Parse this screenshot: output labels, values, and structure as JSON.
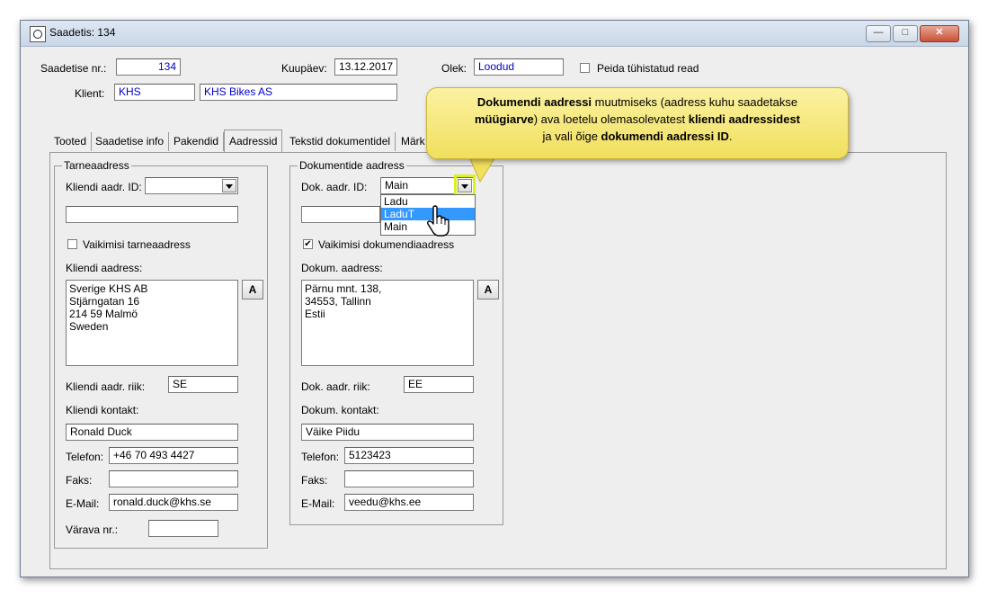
{
  "window": {
    "title": "Saadetis: 134",
    "controls": {
      "minimize": "—",
      "maximize": "□",
      "close": "✕"
    }
  },
  "header": {
    "saadetise_nr_label": "Saadetise nr.:",
    "saadetise_nr_value": "134",
    "kuupaev_label": "Kuupäev:",
    "kuupaev_value": "13.12.2017",
    "olek_label": "Olek:",
    "olek_value": "Loodud",
    "peida_label": "Peida tühistatud read",
    "klient_label": "Klient:",
    "klient_code": "KHS",
    "klient_name": "KHS Bikes AS"
  },
  "tabs": [
    {
      "label": "Tooted"
    },
    {
      "label": "Saadetise info"
    },
    {
      "label": "Pakendid"
    },
    {
      "label": "Aadressid"
    },
    {
      "label": "Tekstid dokumentidel"
    },
    {
      "label": "Märk"
    }
  ],
  "tarneaadress": {
    "legend": "Tarneaadress",
    "kliendi_aadr_id_label": "Kliendi aadr. ID:",
    "kliendi_aadr_id_value": "",
    "extra_field_value": "",
    "vaikimisi_label": "Vaikimisi tarneaadress",
    "kliendi_aadress_label": "Kliendi aadress:",
    "address_lines": [
      "Sverige KHS AB",
      "Stjärngatan 16",
      "214 59 Malmö",
      "Sweden"
    ],
    "a_button": "A",
    "riik_label": "Kliendi aadr. riik:",
    "riik_value": "SE",
    "kontakt_label": "Kliendi kontakt:",
    "kontakt_value": "Ronald Duck",
    "telefon_label": "Telefon:",
    "telefon_value": "+46 70 493 4427",
    "faks_label": "Faks:",
    "faks_value": "",
    "email_label": "E-Mail:",
    "email_value": "ronald.duck@khs.se",
    "varava_label": "Värava nr.:",
    "varava_value": ""
  },
  "dokumentide_aadress": {
    "legend": "Dokumentide aadress",
    "dok_aadr_id_label": "Dok. aadr. ID:",
    "dok_aadr_id_value": "Main",
    "dropdown_options": [
      "Ladu",
      "LaduT",
      "Main"
    ],
    "dropdown_selected": "LaduT",
    "extra_field_value": "",
    "vaikimisi_label": "Vaikimisi dokumendiaadress",
    "dokum_aadress_label": "Dokum. aadress:",
    "address_lines": [
      "Pärnu mnt. 138,",
      "34553, Tallinn",
      "Estii"
    ],
    "a_button": "A",
    "riik_label": "Dok. aadr. riik:",
    "riik_value": "EE",
    "kontakt_label": "Dokum. kontakt:",
    "kontakt_value": "Väike Piidu",
    "telefon_label": "Telefon:",
    "telefon_value": "5123423",
    "faks_label": "Faks:",
    "faks_value": "",
    "email_label": "E-Mail:",
    "email_value": "veedu@khs.ee"
  },
  "callout": {
    "part1": "Dokumendi aadressi",
    "part2": " muutmiseks (aadress kuhu saadetakse",
    "part3": "müügiarve",
    "part4": ") ava loetelu olemasolevatest ",
    "part5": "kliendi aadressidest",
    "part6": "ja vali õige ",
    "part7": "dokumendi  aadressi ID",
    "part8": "."
  },
  "colors": {
    "accent_blue": "#0000cc",
    "selection": "#3399ff",
    "callout": "#f3e26a",
    "highlight": "#ddee22"
  }
}
